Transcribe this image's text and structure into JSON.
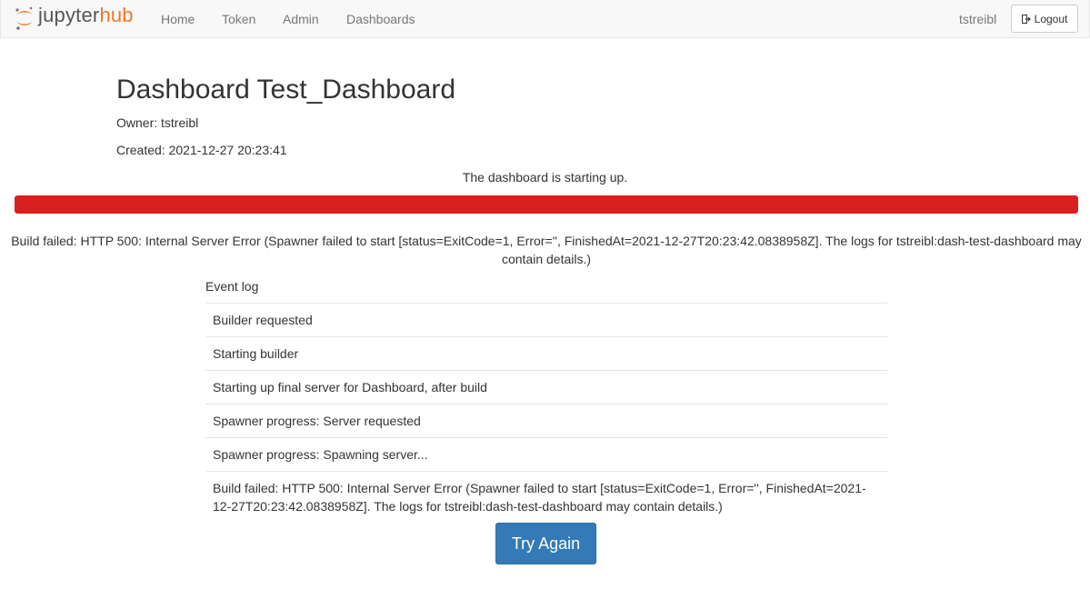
{
  "navbar": {
    "brand": {
      "part1": "jupyter",
      "part2": "hub",
      "accent_color": "#f37626"
    },
    "links": [
      "Home",
      "Token",
      "Admin",
      "Dashboards"
    ],
    "user": "tstreibl",
    "logout_label": "Logout",
    "logout_icon": "sign-out-icon"
  },
  "dashboard": {
    "title": "Dashboard Test_Dashboard",
    "owner": "Owner: tstreibl",
    "created": "Created: 2021-12-27 20:23:41",
    "status": "The dashboard is starting up.",
    "progress_percent": 100,
    "progress_color": "#d9201e",
    "error": "Build failed: HTTP 500: Internal Server Error (Spawner failed to start [status=ExitCode=1, Error='', FinishedAt=2021-12-27T20:23:42.0838958Z]. The logs for tstreibl:dash-test-dashboard may contain details.)"
  },
  "event_log": {
    "heading": "Event log",
    "events": [
      "Builder requested",
      "Starting builder",
      "Starting up final server for Dashboard, after build",
      "Spawner progress: Server requested",
      "Spawner progress: Spawning server...",
      "Build failed: HTTP 500: Internal Server Error (Spawner failed to start [status=ExitCode=1, Error='', FinishedAt=2021-12-27T20:23:42.0838958Z]. The logs for tstreibl:dash-test-dashboard may contain details.)"
    ]
  },
  "try_again_label": "Try Again"
}
